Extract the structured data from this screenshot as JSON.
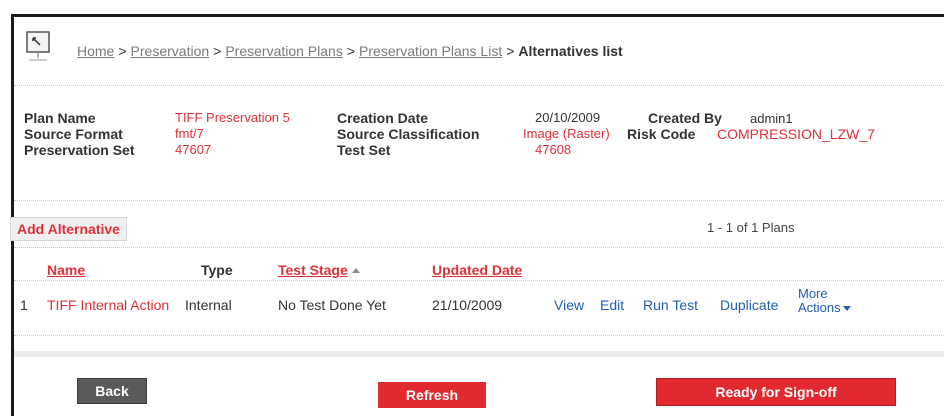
{
  "breadcrumb": {
    "home": "Home",
    "preservation": "Preservation",
    "plans": "Preservation Plans",
    "plans_list": "Preservation Plans List",
    "current": "Alternatives list",
    "separator": ">"
  },
  "plan": {
    "plan_name_label": "Plan Name",
    "plan_name": "TIFF Preservation 5",
    "creation_date_label": "Creation Date",
    "creation_date": "20/10/2009",
    "created_by_label": "Created By",
    "created_by": "admin1",
    "source_format_label": "Source Format",
    "source_format": "fmt/7",
    "source_classification_label": "Source Classification",
    "source_classification": "Image (Raster)",
    "risk_code_label": "Risk Code",
    "risk_code": "COMPRESSION_LZW_7",
    "preservation_set_label": "Preservation Set",
    "preservation_set": "47607",
    "test_set_label": "Test Set",
    "test_set": "47608"
  },
  "toolbar": {
    "add_alternative": "Add Alternative",
    "pager": "1 - 1 of 1 Plans"
  },
  "table": {
    "headers": {
      "name": "Name",
      "type": "Type",
      "test_stage": "Test Stage",
      "updated_date": "Updated Date"
    },
    "rows": [
      {
        "index": "1",
        "name": "TIFF Internal Action",
        "type": "Internal",
        "test_stage": "No Test Done Yet",
        "updated_date": "21/10/2009",
        "actions": {
          "view": "View",
          "edit": "Edit",
          "run_test": "Run Test",
          "duplicate": "Duplicate",
          "more_line1": "More",
          "more_line2": "Actions"
        }
      }
    ]
  },
  "footer": {
    "back": "Back",
    "refresh": "Refresh",
    "sign_off": "Ready for Sign-off"
  },
  "colors": {
    "accent": "#e02a30",
    "link_blue": "#1e5fb5",
    "value_red": "#e0303a"
  }
}
